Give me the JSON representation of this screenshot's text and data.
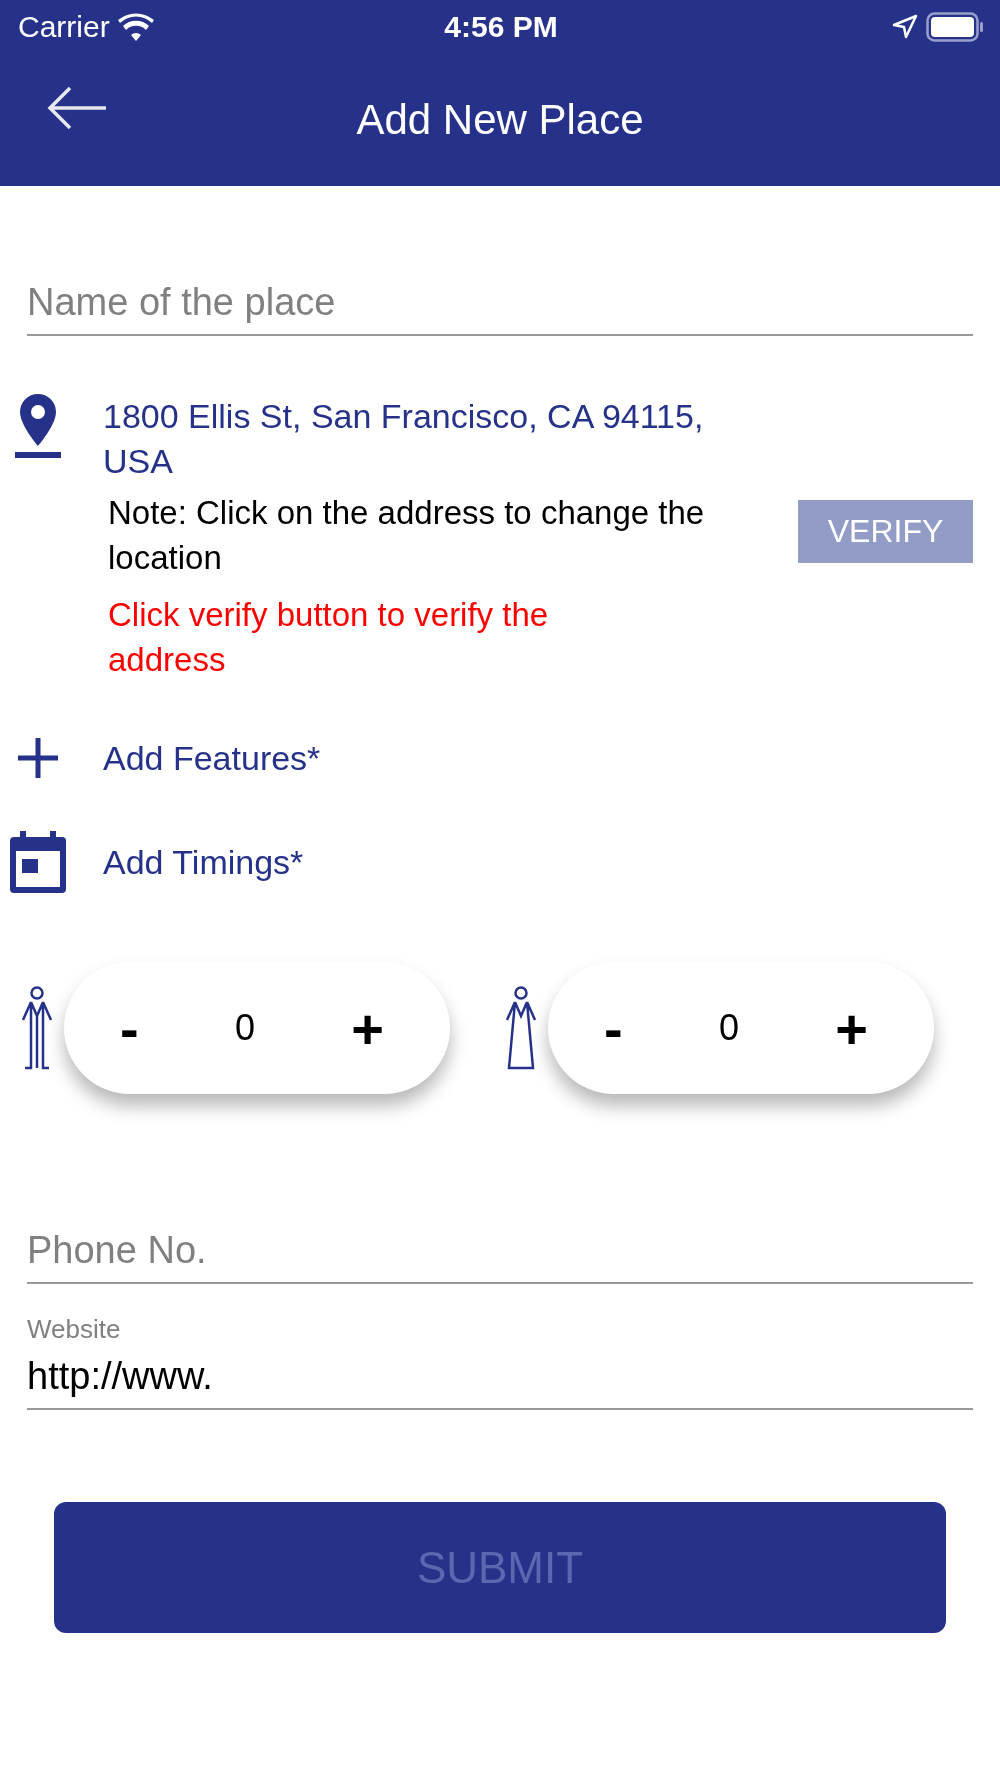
{
  "status_bar": {
    "carrier": "Carrier",
    "time": "4:56 PM"
  },
  "header": {
    "title": "Add New Place"
  },
  "name_field": {
    "placeholder": "Name of the place"
  },
  "address": {
    "text": "1800 Ellis St, San Francisco, CA 94115, USA",
    "note": "Note: Click on the address to change the location",
    "warning": "Click verify button to verify the address",
    "verify_button": {
      "label": "VERIFY",
      "disabled": true
    }
  },
  "actions": [
    {
      "kind": "plus",
      "label": "Add Features*"
    },
    {
      "kind": "calendar",
      "label": "Add Timings*"
    }
  ],
  "counters": [
    {
      "kind": "male",
      "minus": "-",
      "value": "0",
      "plus": "+"
    },
    {
      "kind": "female",
      "minus": "-",
      "value": "0",
      "plus": "+"
    }
  ],
  "phone_field": {
    "placeholder": "Phone No."
  },
  "website_field": {
    "label": "Website",
    "value": "http://www."
  },
  "submit_button": {
    "label": "SUBMIT",
    "disabled": true
  }
}
